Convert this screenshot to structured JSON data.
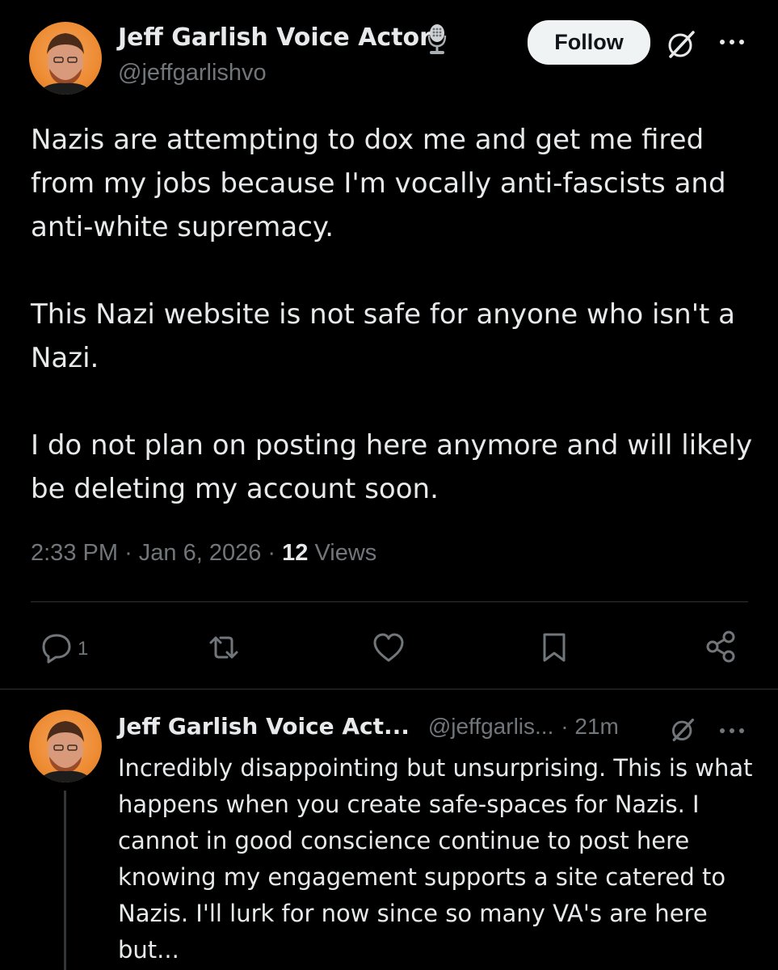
{
  "post": {
    "author_name": "Jeff Garlish Voice Actor",
    "handle": "@jeffgarlishvo",
    "follow_label": "Follow",
    "paragraphs": [
      "Nazis are attempting to dox me and get me fired from my jobs because I'm vocally anti-fascists and anti-white supremacy.",
      "This Nazi website is not safe for anyone who isn't a Nazi.",
      "I do not plan on posting here anymore and will likely be deleting my account soon."
    ],
    "time": "2:33 PM",
    "date": "Jan 6, 2026",
    "views_count": "12",
    "views_label": "Views",
    "reply_count": "1"
  },
  "reply": {
    "author_name": "Jeff Garlish Voice Act...",
    "handle": "@jeffgarlis...",
    "age": "21m",
    "text": "Incredibly disappointing but unsurprising. This is what happens when you create safe-spaces for Nazis. I cannot in good conscience continue to post here knowing my engagement supports a site catered to Nazis. I'll lurk for now since so many VA's are here but..."
  },
  "icons": {
    "verified": "microphone-icon",
    "grok": "grok-icon",
    "more": "more-icon",
    "reply": "reply-icon",
    "repost": "repost-icon",
    "like": "like-icon",
    "bookmark": "bookmark-icon",
    "share": "share-icon"
  },
  "colors": {
    "background": "#000000",
    "text": "#e7e9ea",
    "muted": "#71767b",
    "follow_bg": "#eff3f4",
    "divider": "#2f3336",
    "avatar_orange": "#ee8c34"
  }
}
